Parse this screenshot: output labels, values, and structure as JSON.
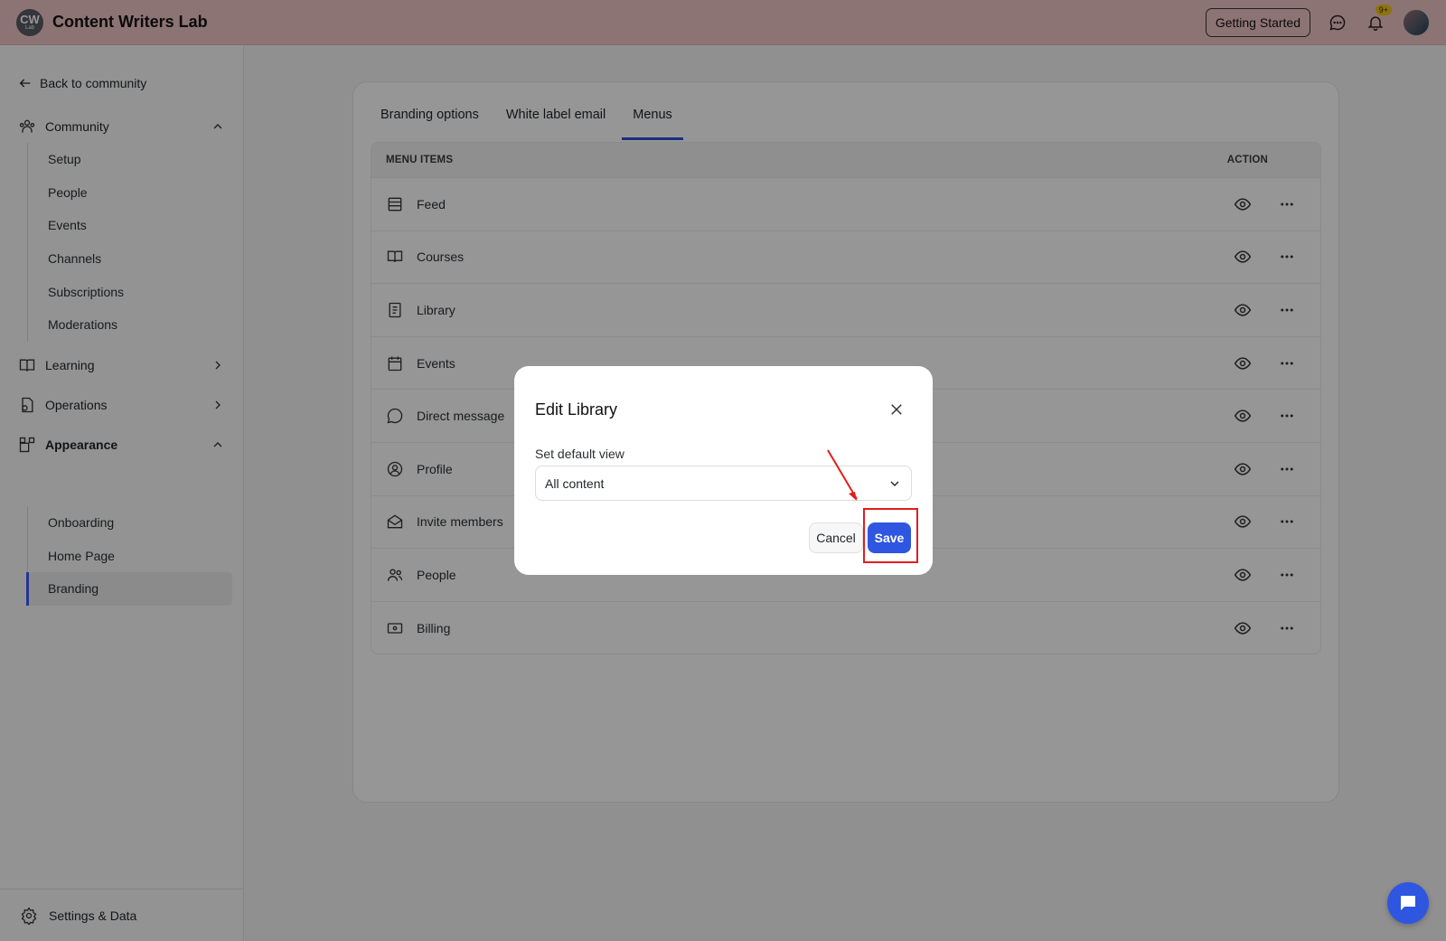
{
  "header": {
    "logo_text": "CW",
    "logo_sub": "Lab",
    "app_title": "Content Writers Lab",
    "getting_started_label": "Getting Started",
    "notification_badge": "9+"
  },
  "sidebar": {
    "back_label": "Back to community",
    "sections": {
      "community": {
        "label": "Community",
        "items": [
          "Setup",
          "People",
          "Events",
          "Channels",
          "Subscriptions",
          "Moderations"
        ]
      },
      "learning": {
        "label": "Learning"
      },
      "operations": {
        "label": "Operations"
      },
      "appearance": {
        "label": "Appearance",
        "items": [
          "Onboarding",
          "Home Page",
          "Branding"
        ],
        "active_item": "Branding"
      }
    },
    "settings_label": "Settings & Data"
  },
  "main": {
    "tabs": [
      {
        "label": "Branding options",
        "active": false
      },
      {
        "label": "White label email",
        "active": false
      },
      {
        "label": "Menus",
        "active": true
      }
    ],
    "table": {
      "col_menu_items": "MENU ITEMS",
      "col_action": "ACTION",
      "rows": [
        {
          "label": "Feed",
          "icon": "feed-icon"
        },
        {
          "label": "Courses",
          "icon": "book-icon"
        },
        {
          "label": "Library",
          "icon": "library-icon"
        },
        {
          "label": "Events",
          "icon": "calendar-icon"
        },
        {
          "label": "Direct message",
          "icon": "message-icon"
        },
        {
          "label": "Profile",
          "icon": "profile-icon"
        },
        {
          "label": "Invite members",
          "icon": "envelope-icon"
        },
        {
          "label": "People",
          "icon": "people-icon"
        },
        {
          "label": "Billing",
          "icon": "billing-icon"
        }
      ]
    }
  },
  "modal": {
    "title": "Edit Library",
    "field_label": "Set default view",
    "select_value": "All content",
    "cancel_label": "Cancel",
    "save_label": "Save"
  },
  "colors": {
    "header_bg": "#f0c6c6",
    "accent": "#2f56e0",
    "highlight": "#e11d1d"
  }
}
